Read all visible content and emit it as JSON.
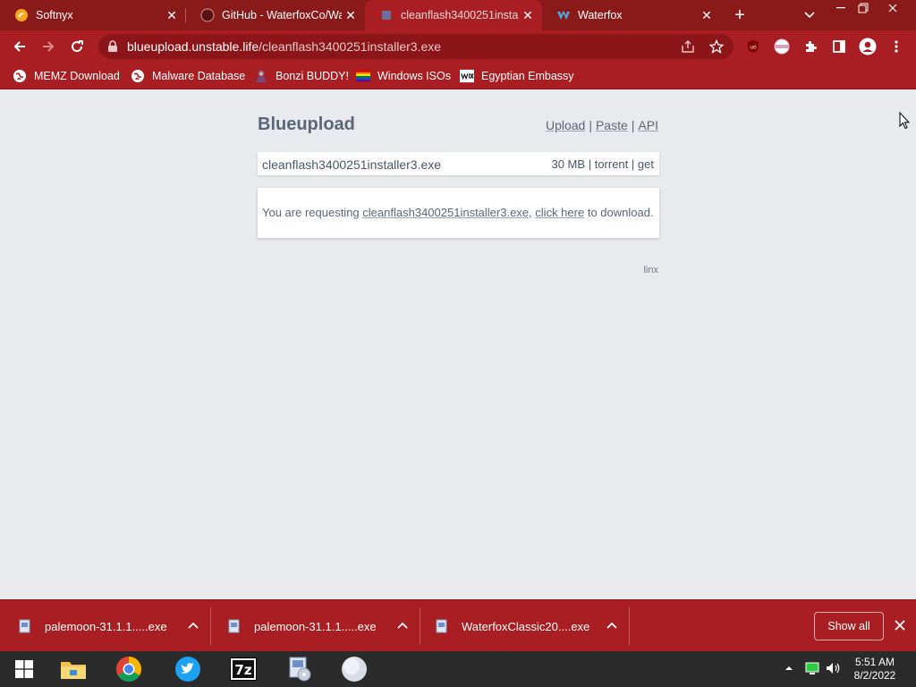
{
  "tabs": [
    {
      "title": "Softnyx",
      "active": false
    },
    {
      "title": "GitHub - WaterfoxCo/Wa",
      "active": false
    },
    {
      "title": "cleanflash3400251installe",
      "active": true
    },
    {
      "title": "Waterfox",
      "active": false
    }
  ],
  "address": {
    "host": "blueupload.unstable.life",
    "path": "/cleanflash3400251installer3.exe"
  },
  "bookmarks": [
    {
      "label": "MEMZ Download"
    },
    {
      "label": "Malware Database"
    },
    {
      "label": "Bonzi BUDDY!"
    },
    {
      "label": "Windows ISOs"
    },
    {
      "label": "Egyptian Embassy"
    }
  ],
  "site": {
    "title": "Blueupload",
    "nav": {
      "upload": "Upload",
      "paste": "Paste",
      "api": "API",
      "sep": "|"
    },
    "file": {
      "name": "cleanflash3400251installer3.exe",
      "size": "30 MB",
      "torrent": "torrent",
      "get": "get",
      "sep": "|"
    },
    "message": {
      "prefix": "You are requesting",
      "filename": "cleanflash3400251installer3.exe",
      "comma": ",",
      "link": "click here",
      "suffix": "to download."
    },
    "footer": "linx"
  },
  "downloads": [
    {
      "name": "palemoon-31.1.1.....exe"
    },
    {
      "name": "palemoon-31.1.1.....exe"
    },
    {
      "name": "WaterfoxClassic20....exe"
    }
  ],
  "shelf": {
    "show_all": "Show all"
  },
  "taskbar": {
    "time": "5:51 AM",
    "date": "8/2/2022",
    "sevenzip_label": "7z"
  },
  "colors": {
    "tab_strip": "#8a1a1a",
    "toolbar": "#a81e22",
    "page_bg": "#e8eaee",
    "taskbar": "#2b2b2b"
  }
}
